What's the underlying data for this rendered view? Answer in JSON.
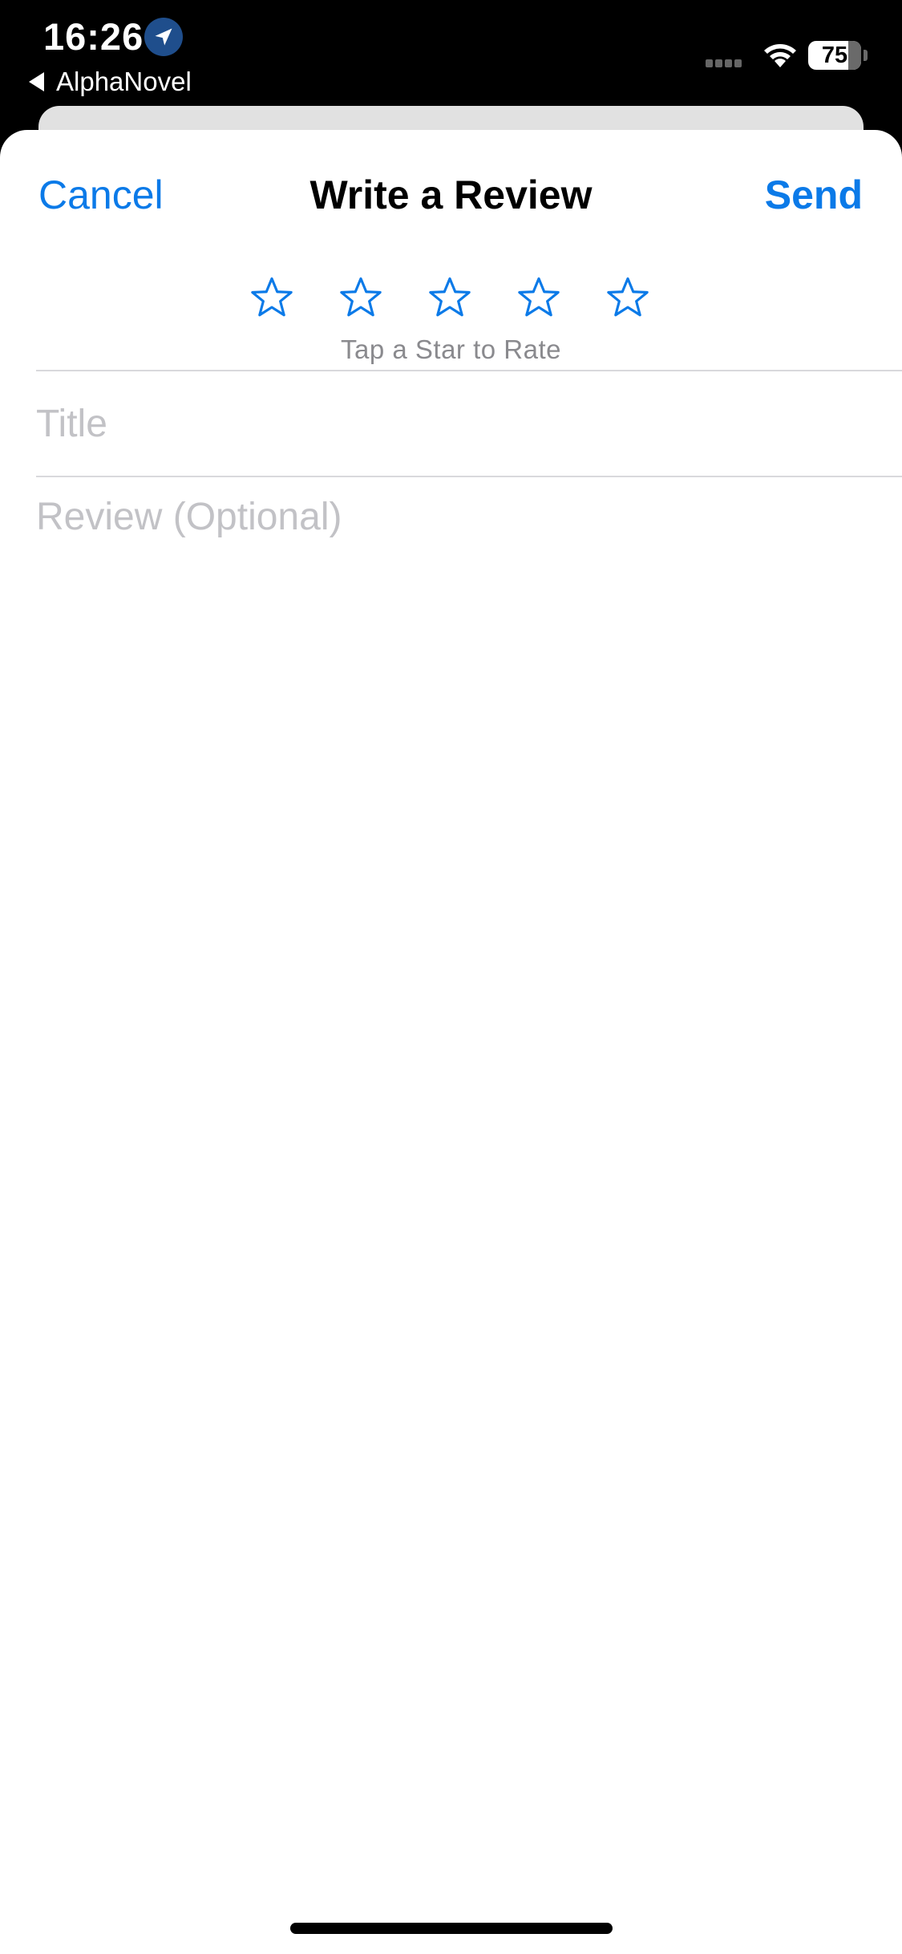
{
  "status_bar": {
    "time": "16:26",
    "back_app": "AlphaNovel",
    "battery": "75",
    "icons": [
      "location-arrow-icon",
      "signal-icon",
      "wifi-icon",
      "battery-icon"
    ]
  },
  "sheet": {
    "cancel_label": "Cancel",
    "title": "Write a Review",
    "send_label": "Send",
    "rating": {
      "max": 5,
      "value": 0,
      "hint": "Tap a Star to Rate"
    },
    "title_field": {
      "placeholder": "Title",
      "value": ""
    },
    "review_field": {
      "placeholder": "Review (Optional)",
      "value": ""
    }
  },
  "colors": {
    "accent": "#0b7ae8",
    "placeholder": "#c2c2c6",
    "hint": "#8a8a8e"
  }
}
